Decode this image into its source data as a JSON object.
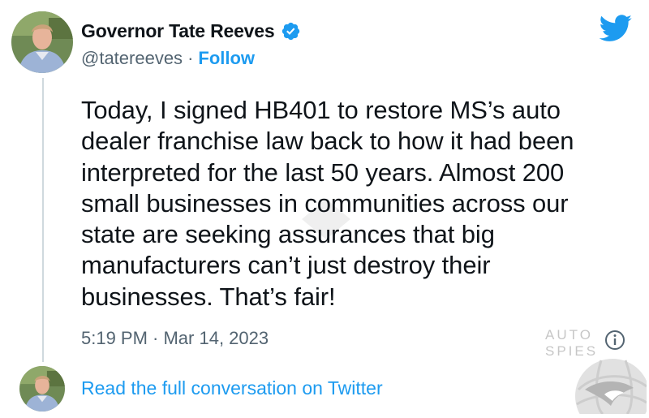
{
  "account": {
    "display_name": "Governor Tate Reeves",
    "handle": "@tatereeves",
    "separator": "·",
    "follow_label": "Follow",
    "verified": true
  },
  "tweet": {
    "text": "Today, I signed HB401 to restore MS’s auto\ndealer franchise law back to how it had been\ninterpreted for the last 50 years. Almost 200\nsmall businesses in communities across our\nstate are seeking assurances that big\nmanufacturers can’t just destroy their\nbusinesses. That’s fair!",
    "timestamp": "5:19 PM · Mar 14, 2023"
  },
  "footer": {
    "read_link": "Read the full conversation on Twitter"
  },
  "watermark": {
    "text": "AUTO SPIES"
  },
  "icons": {
    "brand": "twitter-bird-icon",
    "verified": "verified-badge-icon",
    "info": "info-icon"
  },
  "colors": {
    "accent": "#1d9bf0",
    "text": "#0f1419",
    "secondary": "#536471",
    "thread_line": "#cfd9de"
  }
}
